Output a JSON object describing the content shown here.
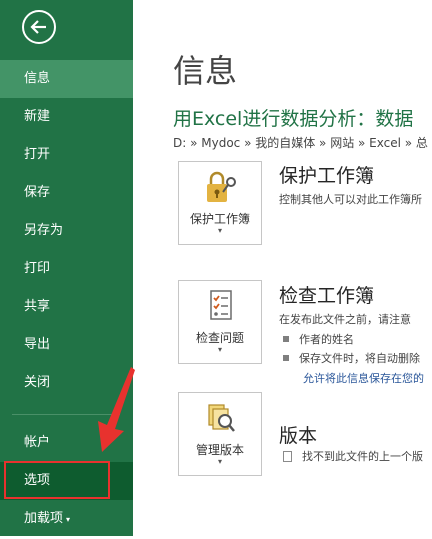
{
  "sidebar": {
    "items": [
      {
        "label": "信息"
      },
      {
        "label": "新建"
      },
      {
        "label": "打开"
      },
      {
        "label": "保存"
      },
      {
        "label": "另存为"
      },
      {
        "label": "打印"
      },
      {
        "label": "共享"
      },
      {
        "label": "导出"
      },
      {
        "label": "关闭"
      },
      {
        "label": "帐户"
      },
      {
        "label": "选项"
      },
      {
        "label": "加载项"
      }
    ],
    "addins_caret": "▾"
  },
  "main": {
    "page_title": "信息",
    "doc_title": "用Excel进行数据分析：数据",
    "doc_path": "D: » Mydoc » 我的自媒体 » 网站 » Excel » 总",
    "protect": {
      "button_label": "保护工作簿",
      "title": "保护工作簿",
      "desc": "控制其他人可以对此工作簿所"
    },
    "inspect": {
      "button_label": "检查问题",
      "title": "检查工作簿",
      "desc": "在发布此文件之前，请注意",
      "bullets": [
        "作者的姓名",
        "保存文件时，将自动删除"
      ],
      "link": "允许将此信息保存在您的"
    },
    "versions": {
      "button_label": "管理版本",
      "title": "版本",
      "desc": "找不到此文件的上一个版"
    },
    "caret": "▾"
  },
  "colors": {
    "sidebar_bg": "#217346",
    "sidebar_active": "#439467",
    "highlight": "#e8322e"
  }
}
